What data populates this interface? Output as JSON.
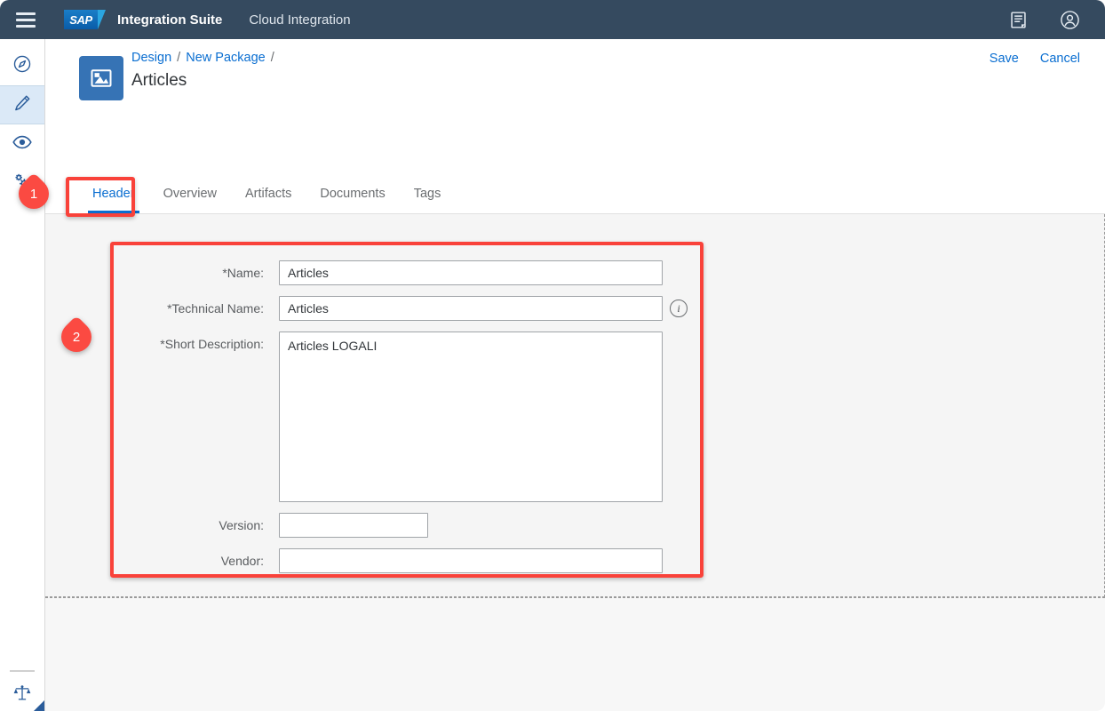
{
  "shellbar": {
    "menu_icon": "hamburger-menu-icon",
    "logo_text": "SAP",
    "product_title": "Integration Suite",
    "service_title": "Cloud Integration",
    "right_icons": [
      {
        "name": "notes-icon",
        "label": "Notes"
      },
      {
        "name": "user-avatar-icon",
        "label": "User"
      }
    ]
  },
  "side_rail": {
    "items": [
      {
        "name": "discover-icon",
        "label": "Discover",
        "active": false
      },
      {
        "name": "design-pencil-icon",
        "label": "Design",
        "active": true
      },
      {
        "name": "monitor-eye-icon",
        "label": "Monitor",
        "active": false
      },
      {
        "name": "settings-gear-icon",
        "label": "Settings",
        "active": false
      }
    ],
    "legal_icon": "legal-scales-icon"
  },
  "page_header": {
    "package_icon": "package-image-icon",
    "breadcrumb": [
      {
        "label": "Design"
      },
      {
        "label": "New Package"
      }
    ],
    "breadcrumb_separator": "/",
    "title": "Articles",
    "actions": [
      {
        "name": "save-button",
        "label": "Save"
      },
      {
        "name": "cancel-button",
        "label": "Cancel"
      }
    ]
  },
  "tabs": [
    {
      "label": "Header",
      "active": true
    },
    {
      "label": "Overview",
      "active": false
    },
    {
      "label": "Artifacts",
      "active": false
    },
    {
      "label": "Documents",
      "active": false
    },
    {
      "label": "Tags",
      "active": false
    }
  ],
  "form": {
    "fields": [
      {
        "label": "*Name:",
        "value": "Articles",
        "placeholder": "",
        "type": "text",
        "width": "full",
        "info": false
      },
      {
        "label": "*Technical Name:",
        "value": "Articles",
        "placeholder": "",
        "type": "text",
        "width": "full",
        "info": true
      },
      {
        "label": "*Short Description:",
        "value": "Articles LOGALI",
        "placeholder": "",
        "type": "textarea",
        "width": "full",
        "info": false
      },
      {
        "label": "Version:",
        "value": "",
        "placeholder": "",
        "type": "text",
        "width": "short",
        "info": false
      },
      {
        "label": "Vendor:",
        "value": "",
        "placeholder": "",
        "type": "text",
        "width": "full",
        "info": false
      }
    ]
  },
  "annotations": [
    {
      "number": "1",
      "target": "header-tab"
    },
    {
      "number": "2",
      "target": "header-form-panel"
    }
  ],
  "colors": {
    "shellbar_bg": "#354a5f",
    "accent_blue": "#0a6ed1",
    "annotation_red": "#f9423a",
    "content_bg": "#f7f7f7",
    "rail_active_bg": "#dbe9f7"
  }
}
